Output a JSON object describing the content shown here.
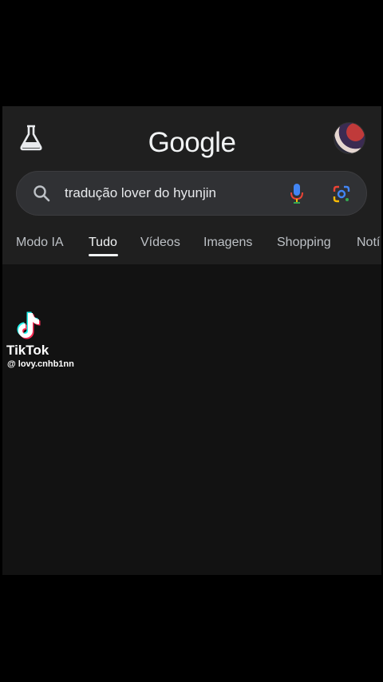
{
  "header": {
    "logo_text": "Google",
    "labs_icon": "flask-icon",
    "avatar_icon": "profile-avatar"
  },
  "search": {
    "query": "tradução lover do hyunjin",
    "search_icon": "search-icon",
    "mic_icon": "microphone-icon",
    "lens_icon": "google-lens-icon"
  },
  "tabs": [
    {
      "label": "Modo IA",
      "active": false
    },
    {
      "label": "Tudo",
      "active": true
    },
    {
      "label": "Vídeos",
      "active": false
    },
    {
      "label": "Imagens",
      "active": false
    },
    {
      "label": "Shopping",
      "active": false
    },
    {
      "label": "Notí",
      "active": false
    }
  ],
  "watermark": {
    "brand": "TikTok",
    "handle": "@ lovy.cnhb1nn",
    "logo_icon": "tiktok-logo-icon"
  },
  "colors": {
    "background": "#000000",
    "panel": "#1f1f1f",
    "search_bg": "#303134",
    "text": "#e8eaed",
    "mic_blue": "#4285f4",
    "mic_red": "#ea4335"
  }
}
